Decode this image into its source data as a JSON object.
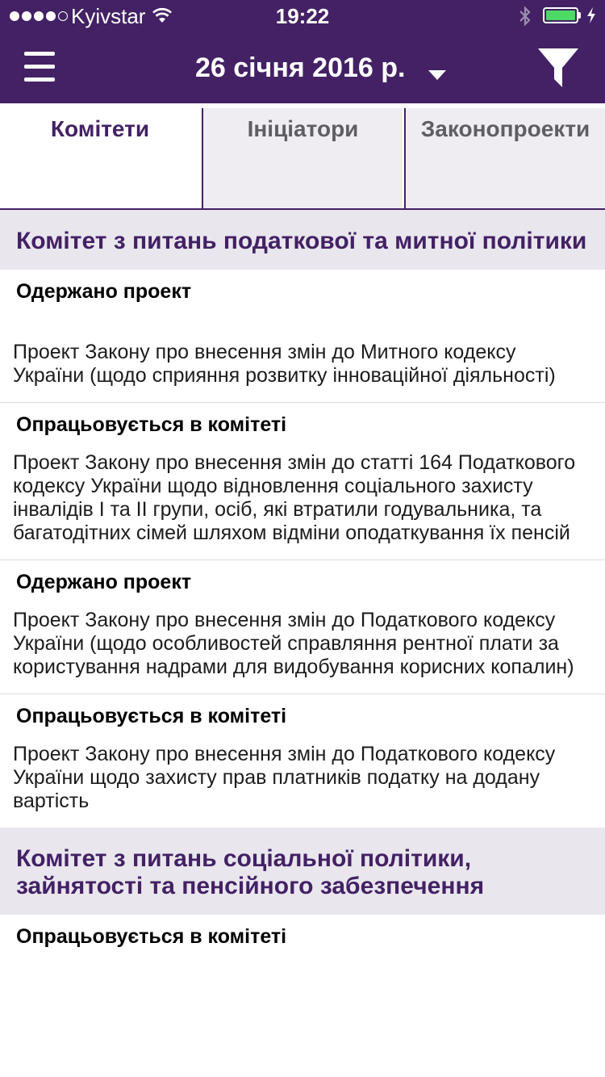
{
  "status_bar": {
    "carrier": "Kyivstar",
    "time": "19:22",
    "colors": {
      "battery": "#4cd964"
    }
  },
  "header": {
    "date": "26 січня 2016 р.",
    "icons": [
      "menu-icon",
      "chevron-down-icon",
      "filter-icon"
    ],
    "colors": {
      "background": "#432164",
      "text": "#ffffff"
    }
  },
  "tabs": [
    {
      "label": "Комітети",
      "active": true
    },
    {
      "label": "Ініціатори",
      "active": false
    },
    {
      "label": "Законопроекти",
      "active": false
    }
  ],
  "sections": [
    {
      "title": "Комітет з питань податкової та митної політики",
      "items": [
        {
          "status": "Одержано проект",
          "text": "Проект Закону про внесення змін до Митного кодексу України (щодо сприяння розвитку інноваційної діяльності)"
        },
        {
          "status": "Опрацьовується в комітеті",
          "text": "Проект Закону про внесення змін до статті 164 Податкового кодексу України щодо відновлення соціального захисту інвалідів І та ІІ групи, осіб, які втратили годувальника, та багатодітних сімей шляхом відміни оподаткування їх пенсій"
        },
        {
          "status": "Одержано проект",
          "text": "Проект Закону про внесення змін до Податкового кодексу України (щодо особливостей справляння рентної плати за користування надрами для видобування корисних копалин)"
        },
        {
          "status": "Опрацьовується в комітеті",
          "text": "Проект Закону про внесення змін до Податкового кодексу України щодо захисту прав платників податку на додану вартість"
        }
      ]
    },
    {
      "title": "Комітет з питань соціальної політики, зайнятості та пенсійного забезпечення",
      "items": [
        {
          "status": "Опрацьовується в комітеті"
        }
      ]
    }
  ],
  "colors": {
    "accent": "#432164",
    "section_background": "#e9e6ee",
    "inactive_tab_background": "#efedf2"
  }
}
